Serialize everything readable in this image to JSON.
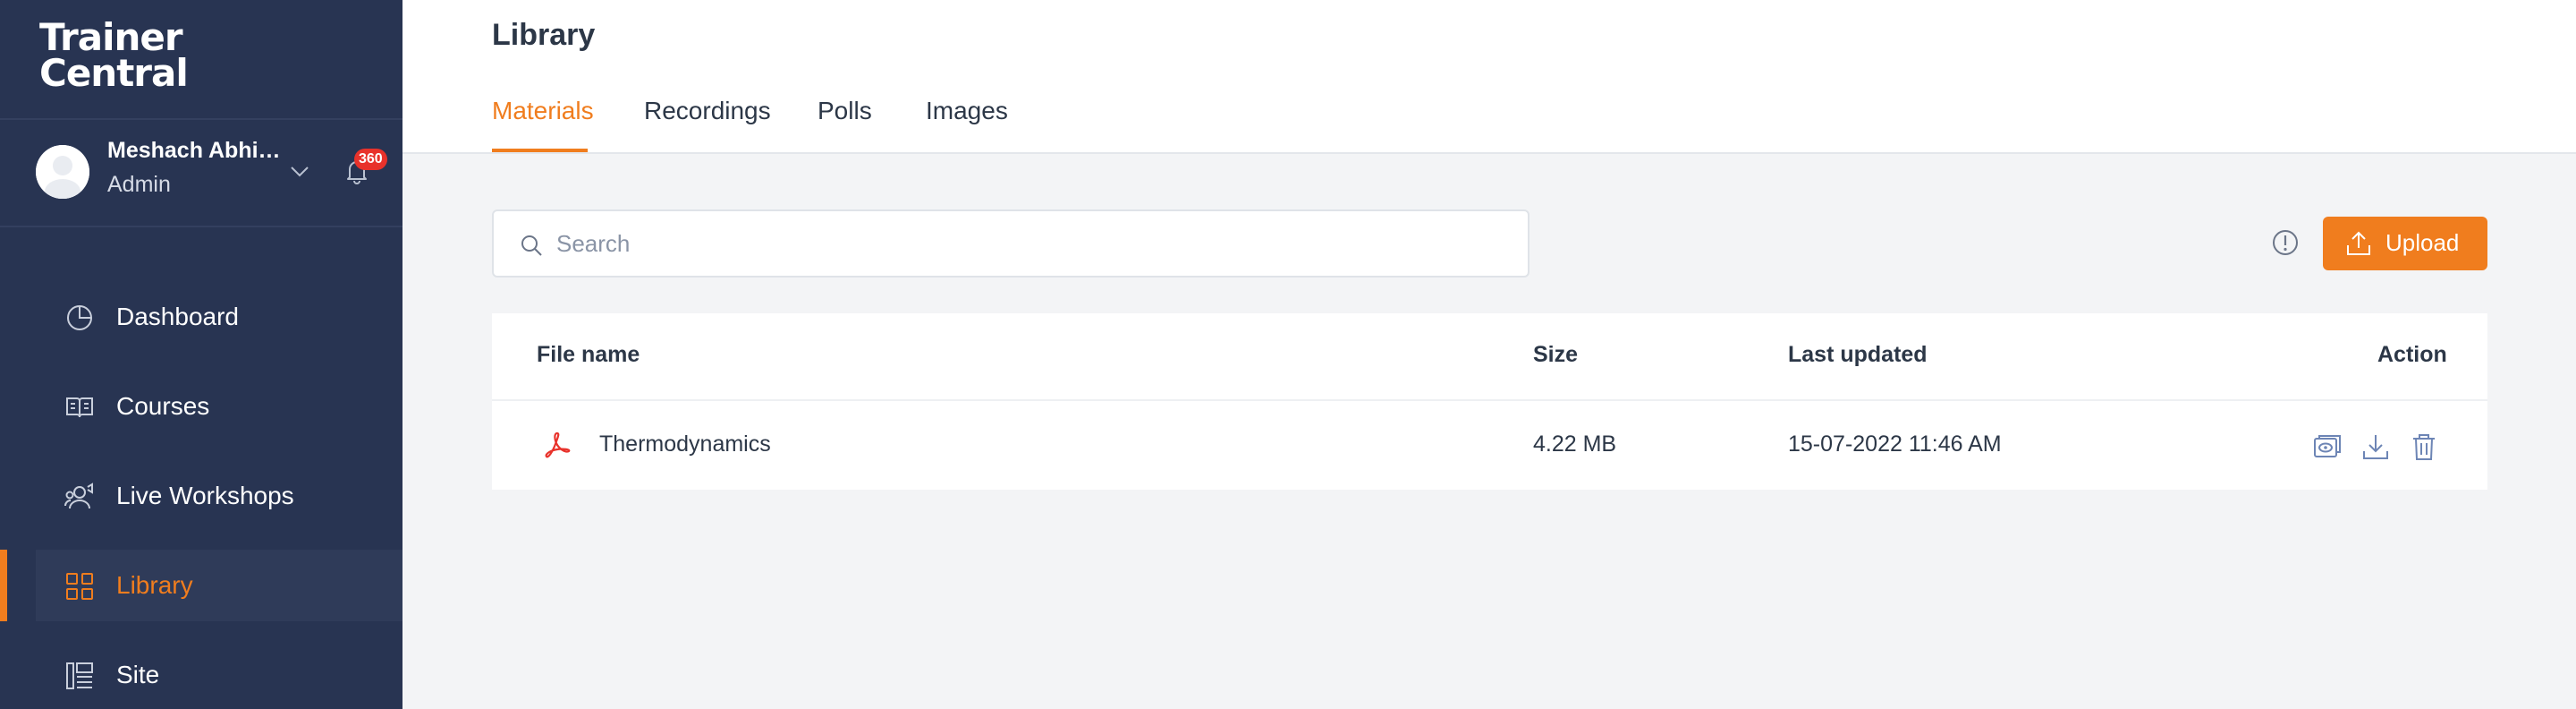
{
  "app": {
    "logo_line1": "Trainer",
    "logo_line2": "Central"
  },
  "profile": {
    "name": "Meshach Abhish…",
    "role": "Admin",
    "notifications": "360"
  },
  "sidebar": {
    "items": [
      {
        "label": "Dashboard",
        "icon": "dashboard-icon"
      },
      {
        "label": "Courses",
        "icon": "book-icon"
      },
      {
        "label": "Live Workshops",
        "icon": "workshop-icon"
      },
      {
        "label": "Library",
        "icon": "grid-icon",
        "active": true
      },
      {
        "label": "Site",
        "icon": "layout-icon"
      }
    ]
  },
  "header": {
    "title": "Library",
    "tabs": [
      {
        "label": "Materials",
        "active": true
      },
      {
        "label": "Recordings"
      },
      {
        "label": "Polls"
      },
      {
        "label": "Images"
      }
    ]
  },
  "search": {
    "placeholder": "Search",
    "value": ""
  },
  "toolbar": {
    "upload_label": "Upload"
  },
  "table": {
    "columns": [
      "File name",
      "Size",
      "Last updated",
      "Action"
    ],
    "rows": [
      {
        "file_name": "Thermodynamics",
        "size": "4.22 MB",
        "last_updated": "15-07-2022 11:46 AM",
        "icon": "pdf-icon"
      }
    ]
  },
  "colors": {
    "sidebar_bg": "#283452",
    "accent": "#f07d1e",
    "badge": "#e8322b",
    "page_bg": "#f3f4f6"
  }
}
